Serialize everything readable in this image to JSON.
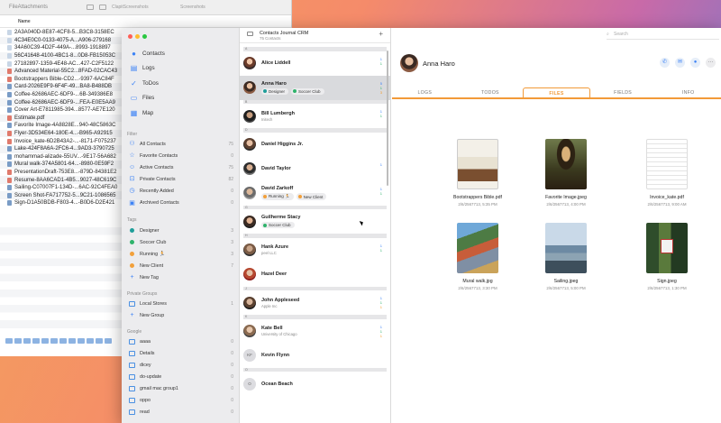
{
  "finder": {
    "path": "FileAttachments",
    "tabs": [
      "ClapitScreenshots",
      "Screenshots"
    ],
    "column_header": "Name",
    "files": [
      {
        "name": "2A3A040D-8E87-4CF8-5...B3C8-3158EC",
        "kind": "doc"
      },
      {
        "name": "4C34E0C0-0133-4075-A...A906-279168",
        "kind": "doc"
      },
      {
        "name": "34A60C39-4D2F-449A-...8993-1918897",
        "kind": "doc"
      },
      {
        "name": "56C41648-4100-4BC1-8...0D8-FB15053C",
        "kind": "doc"
      },
      {
        "name": "27182897-1359-4E48-AC...427-C2F5122",
        "kind": "doc"
      },
      {
        "name": "Advanced Material-55C2...8FAD-02CAC43",
        "kind": "pdf"
      },
      {
        "name": "Bootstrappers Bible-CD2...-9397-6AC84F",
        "kind": "pdf"
      },
      {
        "name": "Card-2026E9F9-6F4F-49...BA8-B488DB",
        "kind": "img"
      },
      {
        "name": "Coffee-62686AEC-6DF9-...6B-349386E8",
        "kind": "img"
      },
      {
        "name": "Coffee-62686AEC-6DF9-...FEA-E0E5AA9",
        "kind": "img"
      },
      {
        "name": "Cover Art-E7811985-394...8577-AE7E120",
        "kind": "img"
      },
      {
        "name": "Estimate.pdf",
        "kind": "pdf"
      },
      {
        "name": "Favorite Image-4A8828E...940-48C5863C",
        "kind": "img"
      },
      {
        "name": "Flyer-3D534E64-180E-4...-B965-A92915",
        "kind": "pdf"
      },
      {
        "name": "Invoice_kate-6D2B43A2-...-8171-F075237",
        "kind": "pdf"
      },
      {
        "name": "Lake-424F8A6A-2FC6-4...9AD3-3790725",
        "kind": "img"
      },
      {
        "name": "mohammad-alizade-55UV...-9E17-56A682",
        "kind": "img"
      },
      {
        "name": "Mural walk-374A5801-64...-8980-0E59F2",
        "kind": "img"
      },
      {
        "name": "PresentationDraft-753E8...-879D-84381E2",
        "kind": "pdf"
      },
      {
        "name": "Resume-8AA6CAD1-4B5...9027-48C619C",
        "kind": "pdf"
      },
      {
        "name": "Sailing-C07007F1-134D-...6AC-92C4FEA0",
        "kind": "img"
      },
      {
        "name": "Screen Shot-FA717752-5...9C21-1086565",
        "kind": "img"
      },
      {
        "name": "Sign-D1A50BDB-F803-4...-B0D6-D2E421",
        "kind": "img"
      }
    ]
  },
  "sidebar": {
    "nav": [
      {
        "label": "Contacts",
        "icon": "person-icon"
      },
      {
        "label": "Logs",
        "icon": "document-icon"
      },
      {
        "label": "ToDos",
        "icon": "checkmark-icon"
      },
      {
        "label": "Files",
        "icon": "folder-icon"
      },
      {
        "label": "Map",
        "icon": "map-icon"
      }
    ],
    "filter_title": "Filter",
    "filters": [
      {
        "label": "All Contacts",
        "count": "75"
      },
      {
        "label": "Favorite Contacts",
        "count": "0"
      },
      {
        "label": "Active Contacts",
        "count": "75"
      },
      {
        "label": "Private Contacts",
        "count": "82"
      },
      {
        "label": "Recently Added",
        "count": "0"
      },
      {
        "label": "Archived Contacts",
        "count": "0"
      }
    ],
    "tags_title": "Tags",
    "tags": [
      {
        "label": "Designer",
        "count": "3",
        "color": "#1f9e9a"
      },
      {
        "label": "Soccer Club",
        "count": "3",
        "color": "#2fb36b"
      },
      {
        "label": "Running 🏃",
        "count": "3",
        "color": "#f2a03a"
      },
      {
        "label": "New Client",
        "count": "7",
        "color": "#f2a03a"
      },
      {
        "label": "New Tag",
        "count": "",
        "color": "#3b82f6"
      }
    ],
    "private_groups_title": "Private Groups",
    "private_groups": [
      {
        "label": "Local Stores",
        "count": "1"
      },
      {
        "label": "New Group",
        "count": ""
      }
    ],
    "google_title": "Google",
    "google_groups": [
      {
        "label": "aaaa",
        "count": "0"
      },
      {
        "label": "Details",
        "count": "0"
      },
      {
        "label": "dicey",
        "count": "0"
      },
      {
        "label": "do-update",
        "count": "0"
      },
      {
        "label": "gmail mac group1",
        "count": "0"
      },
      {
        "label": "oppo",
        "count": "0"
      },
      {
        "label": "read",
        "count": "0"
      }
    ]
  },
  "contacts": {
    "title": "Contacts Journal CRM",
    "subtitle": "75 Contacts",
    "rows": [
      {
        "letter": "A",
        "name": "Alice Liddell",
        "sub": "",
        "tags": [],
        "meta": [
          "1",
          "1"
        ]
      },
      {
        "letter": "",
        "name": "Anna Haro",
        "sub": "",
        "tags": [
          {
            "label": "Designer",
            "color": "#1f9e9a"
          },
          {
            "label": "Soccer Club",
            "color": "#2fb36b"
          }
        ],
        "meta": [
          "5",
          "1",
          "3"
        ],
        "selected": true
      },
      {
        "letter": "B",
        "name": "Bill Lumbergh",
        "sub": "Initech",
        "tags": [],
        "meta": [
          "1",
          "1"
        ]
      },
      {
        "letter": "D",
        "name": "Daniel Higgins Jr.",
        "sub": "",
        "tags": [],
        "meta": []
      },
      {
        "letter": "",
        "name": "David Taylor",
        "sub": "",
        "tags": [],
        "meta": [
          "1"
        ]
      },
      {
        "letter": "",
        "name": "David Zarkoff",
        "sub": "",
        "tags": [
          {
            "label": "Running 🏃",
            "color": "#f2a03a"
          },
          {
            "label": "New Client",
            "color": "#f2a03a"
          }
        ],
        "meta": [
          "1",
          "1"
        ]
      },
      {
        "letter": "G",
        "name": "Guilherme Stacy",
        "sub": "",
        "tags": [
          {
            "label": "Soccer Club",
            "color": "#2fb36b"
          }
        ],
        "meta": []
      },
      {
        "letter": "H",
        "name": "Hank Azure",
        "sub": "peel LLC",
        "tags": [],
        "meta": [
          "1",
          "1"
        ]
      },
      {
        "letter": "",
        "name": "Hazel Deer",
        "sub": "",
        "tags": [],
        "meta": []
      },
      {
        "letter": "J",
        "name": "John Appleseed",
        "sub": "Apple Inc",
        "tags": [],
        "meta": [
          "1",
          "1",
          "1"
        ]
      },
      {
        "letter": "K",
        "name": "Kate Bell",
        "sub": "University of Chicago",
        "tags": [],
        "meta": [
          "1",
          "1",
          "1"
        ]
      },
      {
        "letter": "",
        "name": "Kevin Flynn",
        "sub": "",
        "tags": [],
        "meta": [],
        "initials": "KF"
      },
      {
        "letter": "O",
        "name": "Ocean Beach",
        "sub": "",
        "tags": [],
        "meta": [],
        "initials": "O"
      }
    ]
  },
  "detail": {
    "search_placeholder": "Search",
    "name": "Anna Haro",
    "actions": [
      "phone-icon",
      "mail-icon",
      "message-icon",
      "more-icon"
    ],
    "tabs": [
      {
        "label": "LOGS",
        "active": false
      },
      {
        "label": "TODOS",
        "active": false
      },
      {
        "label": "FILES",
        "active": true
      },
      {
        "label": "FIELDS",
        "active": false
      },
      {
        "label": "INFO",
        "active": false
      }
    ],
    "files": [
      {
        "name": "Bootstrappers Bible.pdf",
        "date": "2/6/2567713, 5:35 PM",
        "thumb": "th-book"
      },
      {
        "name": "Favorite Image.jpeg",
        "date": "2/6/2567713, 4:00 PM",
        "thumb": "th-mona"
      },
      {
        "name": "Invoice_kate.pdf",
        "date": "2/6/2567713, 9:00 AM",
        "thumb": "th-invoice"
      },
      {
        "name": "Mural walk.jpg",
        "date": "2/6/2567713, 3:30 PM",
        "thumb": "th-mural"
      },
      {
        "name": "Sailing.jpeg",
        "date": "2/6/2567713, 5:00 PM",
        "thumb": "th-sail"
      },
      {
        "name": "Sign.jpeg",
        "date": "2/6/2567713, 1:30 PM",
        "thumb": "th-sign"
      }
    ]
  }
}
